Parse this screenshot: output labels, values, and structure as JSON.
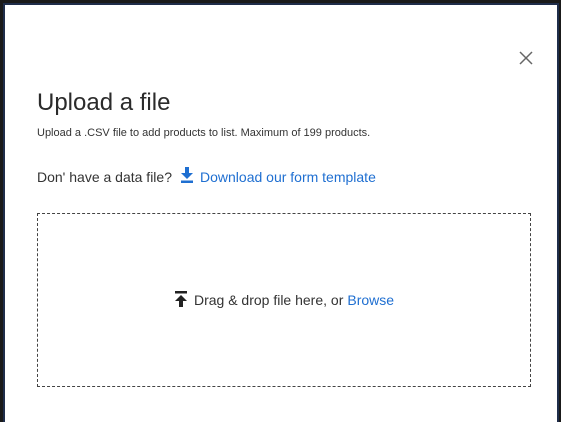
{
  "dialog": {
    "title": "Upload a file",
    "subtitle": "Upload a .CSV file to add products to list. Maximum of 199 products.",
    "close_icon": "close-icon"
  },
  "template": {
    "prompt": "Don' have a data file?",
    "link_label": "Download our form template",
    "link_icon": "download-icon"
  },
  "dropzone": {
    "icon": "upload-icon",
    "text": "Drag & drop file here, or",
    "browse_label": "Browse"
  },
  "colors": {
    "accent": "#1f6fd1",
    "border": "#1f2d4a"
  }
}
